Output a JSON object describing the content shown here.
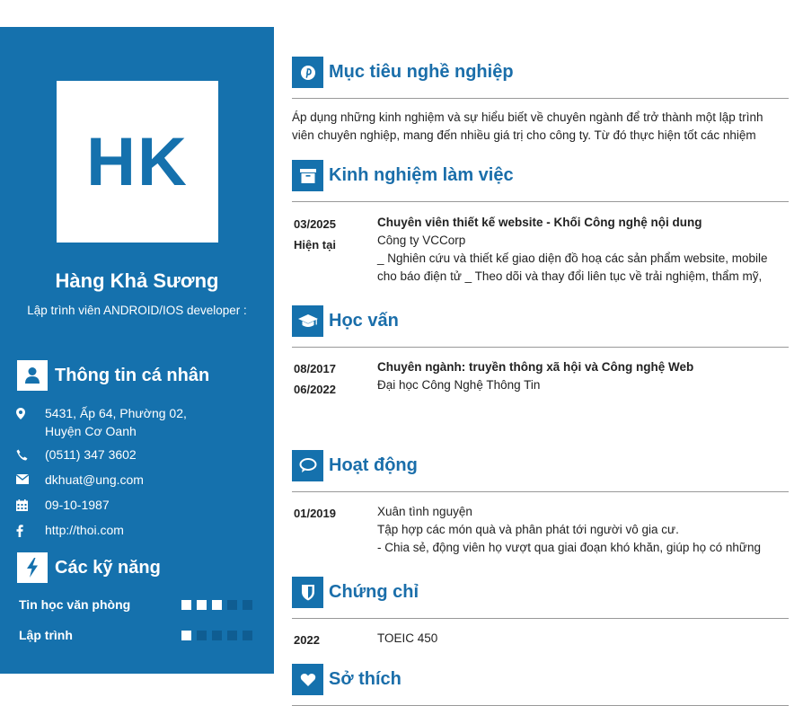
{
  "profile": {
    "initials": "HK",
    "name": "Hàng Khả Sương",
    "role": "Lập trình viên ANDROID/IOS developer :"
  },
  "personal": {
    "title": "Thông tin cá nhân",
    "address_line1": "5431, Ấp 64, Phường 02,",
    "address_line2": "Huyện Cơ Oanh",
    "phone": "(0511) 347 3602",
    "email": "dkhuat@ung.com",
    "birthday": "09-10-1987",
    "website": "http://thoi.com"
  },
  "skills": {
    "title": "Các kỹ năng",
    "items": [
      {
        "label": "Tin học văn phòng",
        "level": 3,
        "max": 5
      },
      {
        "label": "Lập trình",
        "level": 1,
        "max": 5
      }
    ]
  },
  "objective": {
    "title": "Mục tiêu nghề nghiệp",
    "line1": "Áp dụng những kinh nghiệm  và sự hiểu biết về chuyên ngành để trở thành một lập trình",
    "line2": "viên chuyên nghiệp, mang đến nhiều giá trị cho công ty. Từ đó thực hiện tốt các nhiệm"
  },
  "experience": {
    "title": "Kinh nghiệm làm việc",
    "date_from": "03/2025",
    "date_to": "Hiện tại",
    "position": "Chuyên viên thiết kế website - Khối Công nghệ nội dung",
    "company": "Công ty VCCorp",
    "desc1": "_ Nghiên cứu và thiết kế giao diện đồ hoạ các sản phẩm website, mobile",
    "desc2": "cho báo điện tử  _ Theo dõi và thay đổi liên tục về trải nghiệm, thẩm mỹ,"
  },
  "education": {
    "title": "Học vấn",
    "date_from": "08/2017",
    "date_to": "06/2022",
    "major": "Chuyên ngành: truyền thông xã hội và Công nghệ Web",
    "school": "Đại học Công Nghệ Thông Tin"
  },
  "activities": {
    "title": "Hoạt động",
    "date": "01/2019",
    "name": "Xuân tình nguyện",
    "desc1": "Tập hợp các món quà và phân phát tới người vô gia cư.",
    "desc2": "- Chia sẻ, động viên họ vượt qua giai đoạn khó khăn, giúp họ có những"
  },
  "certificates": {
    "title": "Chứng chỉ",
    "year": "2022",
    "name": "TOEIC 450"
  },
  "hobbies": {
    "title": "Sở thích"
  },
  "colors": {
    "primary": "#1571ad",
    "heading": "#1a6eaa"
  }
}
